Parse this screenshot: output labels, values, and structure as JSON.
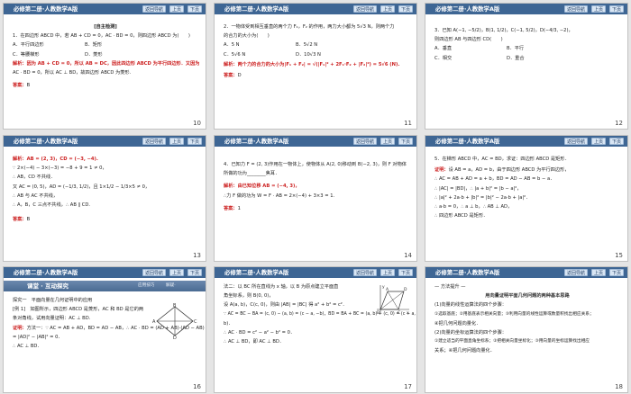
{
  "header": {
    "title": "必修第二册·人教数学A版",
    "nav_label": "返回导航",
    "prev_label": "上页",
    "next_label": "下页"
  },
  "slides": [
    {
      "page": "10",
      "lines": [
        "[自主检测]",
        "1．在四边形 ABCD 中，若 AB + CD = 0，AC · BD = 0，则四边形 ABCD 为(　　)",
        "A．平行四边形",
        "B．矩形",
        "C．等腰梯形",
        "D．菱形"
      ],
      "analysis": [
        "解析：因为 AB + CD = 0，所以 AB = DC，因此四边形 ABCD 为平行四边形．又因为",
        "AC · BD = 0，所以 AC ⊥ BD，故四边形 ABCD 为菱形."
      ],
      "answer_label": "答案：",
      "answer": "B"
    },
    {
      "page": "11",
      "lines": [
        "2．一物体受到相互垂直的两个力 F₁，F₂ 的作用，两力大小都为 5√3 N，则两个力",
        "的合力的大小为(　　)"
      ],
      "options": [
        "A．5 N",
        "B．5√2 N",
        "C．5√6 N",
        "D．10√3 N"
      ],
      "analysis": [
        "解析：两个力的合力的大小为|F₁ + F₂| = √(|F₁|² + 2F₁·F₂ + |F₂|²) = 5√6 (N)."
      ],
      "answer_label": "答案：",
      "answer": "D"
    },
    {
      "page": "12",
      "lines": [
        "3．已知 A(−1, −5/2)，B(1, 1/2)，C(−1, 5/2)，D(−4/3, −2)，",
        "则四边形 AB 与四边形 CD(　　)"
      ],
      "options": [
        "A．垂直",
        "B．平行",
        "C．相交",
        "D．重合"
      ]
    },
    {
      "page": "13",
      "lines": [
        "解析：AB = (2, 3)，CD = (−3, −4).",
        "∵ 2×(−4) − 3×(−3) = −8 + 9 = 1 ≠ 0，",
        "∴ AB，CD 不共线．",
        "又 AC = (0, 5)，AD = (−1/3, 1/2)，且 1×1/2 − 1/3×5 ≠ 0，",
        "∴ AB 与 AC 不共线，",
        "∴ A，B，C 三点不共线，∴ AB ∥ CD."
      ],
      "answer_label": "答案：",
      "answer": "B"
    },
    {
      "page": "14",
      "lines": [
        "4．已知力 F = (2, 3)作用在一物体上，使物体从 A(2, 0)移动到 B(−2, 3)，则 F 对物体",
        "所做的功为________焦耳．"
      ],
      "analysis": [
        "解析：由已知位移 AB = (−4, 3)，",
        "∴力 F 做的功为 W = F · AB = 2×(−4) + 3×3 = 1."
      ],
      "answer_label": "答案：",
      "answer": "1"
    },
    {
      "page": "15",
      "lines": [
        "5．在梯形 ABCD 中，AC = BD，求证：四边形 ABCD 是矩形．"
      ],
      "proof_label": "证明：",
      "proof": [
        "设 AB = a，AD = b，由于四边形 ABCD 为平行四边形，",
        "∴ AC = AB + AD = a + b，BD = AD − AB = b − a．",
        "∴ |AC| = |BD|，∴ |a + b|² = |b − a|²，",
        "∴ |a|² + 2a·b + |b|² = |b|² − 2a·b + |a|²．",
        "∴ a·b = 0，∴ a ⊥ b，∴ AB ⊥ AD，",
        "∴ 四边形 ABCD 是矩形．"
      ]
    },
    {
      "page": "16",
      "band_title": "课堂 · 互动探究",
      "band_right1": "应用技巧",
      "band_right2": "解疑·",
      "explore": "探究一　平面向量在几何证明中的应用",
      "lines": [
        "[例 1]　如图所示，四边形 ABCD 是菱形，AC 和 BD 是它的两",
        "条对角线，试用向量证明：AC ⊥ BD."
      ],
      "proof_label": "证明：",
      "proof": [
        "方法一：∵ AC = AB + AD，BD = AD − AB，∴ AC · BD = (AD + AB)·(AD − AB)",
        "= |AD|² − |AB|² = 0．",
        "∴ AC ⊥ BD．"
      ],
      "diagram_labels": [
        "A",
        "B",
        "C",
        "D"
      ]
    },
    {
      "page": "17",
      "lines": [
        "法二：以 BC 所在直线为 x 轴，以 B 为原点建立平面直",
        "角坐标系，则 B(0, 0)，",
        "设 A(a, b)，C(c, 0)，则由 |AB| = |BC| 得 a² + b² = c²．",
        "∵ AC = BC − BA = (c, 0) − (a, b) = (c − a, −b)，BD = BA + BC = (a, b) + (c, 0) = (c + a,",
        "b)．",
        "∴ AC · BD = c² − a² − b² = 0．",
        "∴ AC ⊥ BD，即 AC ⊥ BD．"
      ],
      "diagram_labels": [
        "y",
        "A",
        "D",
        "B",
        "C",
        "x"
      ]
    },
    {
      "page": "18",
      "method_label": "方法提升",
      "section_title": "用向量证明平面几何问题的两种基本思路",
      "lines": [
        "(1)向量的线性运算法的四个步骤：",
        "①选取基底；②用基底表示相关向量；③利用向量的线性运算或数量积找出相应关系；",
        "④把几何问题向量化．",
        "(2)向量的坐标运算法的四个步骤：",
        "①建立适当的平面直角坐标系；②把相关向量坐标化；③用向量的坐标运算找出相应",
        "关系；④把几何问题向量化．"
      ]
    }
  ]
}
